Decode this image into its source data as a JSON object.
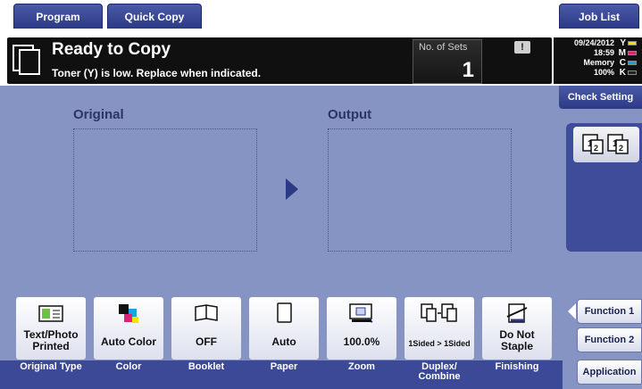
{
  "tabs": [
    {
      "label": "Program"
    },
    {
      "label": "Quick Copy"
    },
    {
      "label": "Job List"
    }
  ],
  "status": {
    "title": "Ready to Copy",
    "message": "Toner (Y) is low. Replace when indicated.",
    "sets_label": "No. of Sets",
    "sets_value": "1",
    "alert_glyph": "!",
    "date": "09/24/2012",
    "time": "18:59",
    "memory_label": "Memory",
    "memory_value": "100%",
    "toner": [
      {
        "letter": "Y",
        "color": "#f2e400"
      },
      {
        "letter": "M",
        "color": "#e0207a"
      },
      {
        "letter": "C",
        "color": "#1aa3e0"
      },
      {
        "letter": "K",
        "color": "#222222"
      }
    ]
  },
  "check_setting": "Check Setting",
  "preview": {
    "original_label": "Original",
    "output_label": "Output"
  },
  "functions": [
    {
      "value": "Text/Photo\nPrinted",
      "label": "Original Type",
      "icon": "original-type-icon"
    },
    {
      "value": "Auto Color",
      "label": "Color",
      "icon": "color-icon"
    },
    {
      "value": "OFF",
      "label": "Booklet",
      "icon": "booklet-icon"
    },
    {
      "value": "Auto",
      "label": "Paper",
      "icon": "paper-icon"
    },
    {
      "value": "100.0%",
      "label": "Zoom",
      "icon": "zoom-icon"
    },
    {
      "value": "1Sided > 1Sided",
      "label": "Duplex/\nCombine",
      "icon": "duplex-icon"
    },
    {
      "value": "Do Not\nStaple",
      "label": "Finishing",
      "icon": "finishing-icon"
    }
  ],
  "side": {
    "function1": "Function 1",
    "function2": "Function 2",
    "application": "Application"
  },
  "colors": {
    "accent": "#2c3a86",
    "background": "#8694c4"
  }
}
